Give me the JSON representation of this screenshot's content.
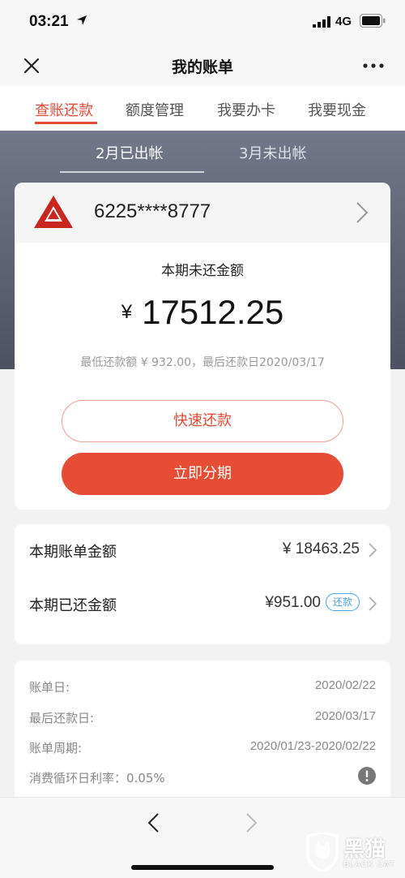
{
  "status_bar": {
    "time": "03:21",
    "network": "4G"
  },
  "nav": {
    "title": "我的账单"
  },
  "tabs": [
    {
      "label": "查账还款",
      "active": true
    },
    {
      "label": "额度管理",
      "active": false
    },
    {
      "label": "我要办卡",
      "active": false
    },
    {
      "label": "我要现金",
      "active": false
    }
  ],
  "months": [
    {
      "label": "2月已出帐",
      "active": true
    },
    {
      "label": "3月未出帐",
      "active": false
    }
  ],
  "card": {
    "number": "6225****8777",
    "unpaid_label": "本期未还金额",
    "currency": "¥",
    "unpaid_amount": "17512.25",
    "min_info": "最低还款额 ¥ 932.00，最后还款日2020/03/17",
    "quick_repay_label": "快速还款",
    "installment_label": "立即分期"
  },
  "summary": {
    "bill_amount_label": "本期账单金额",
    "bill_amount_value": "¥  18463.25",
    "paid_label": "本期已还金额",
    "paid_value": "¥951.00",
    "paid_tag": "还款"
  },
  "details": [
    {
      "label": "账单日:",
      "value": "2020/02/22"
    },
    {
      "label": "最后还款日:",
      "value": "2020/03/17"
    },
    {
      "label": "账单周期:",
      "value": "2020/01/23-2020/02/22"
    },
    {
      "label": "消费循环日利率：0.05%",
      "value": ""
    }
  ],
  "watermark": {
    "text": "黑猫",
    "sub": "BLACK CAT"
  },
  "colors": {
    "accent": "#e24a35",
    "button": "#e74c35",
    "header_dark": "#5a5f6e",
    "tag_blue": "#4aa2e0",
    "logo_red": "#c8261e"
  },
  "icons": [
    "location-arrow-icon",
    "signal-icon",
    "battery-icon",
    "close-icon",
    "more-icon",
    "bank-logo",
    "chevron-right-icon",
    "info-icon",
    "back-arrow-icon",
    "forward-arrow-icon"
  ]
}
